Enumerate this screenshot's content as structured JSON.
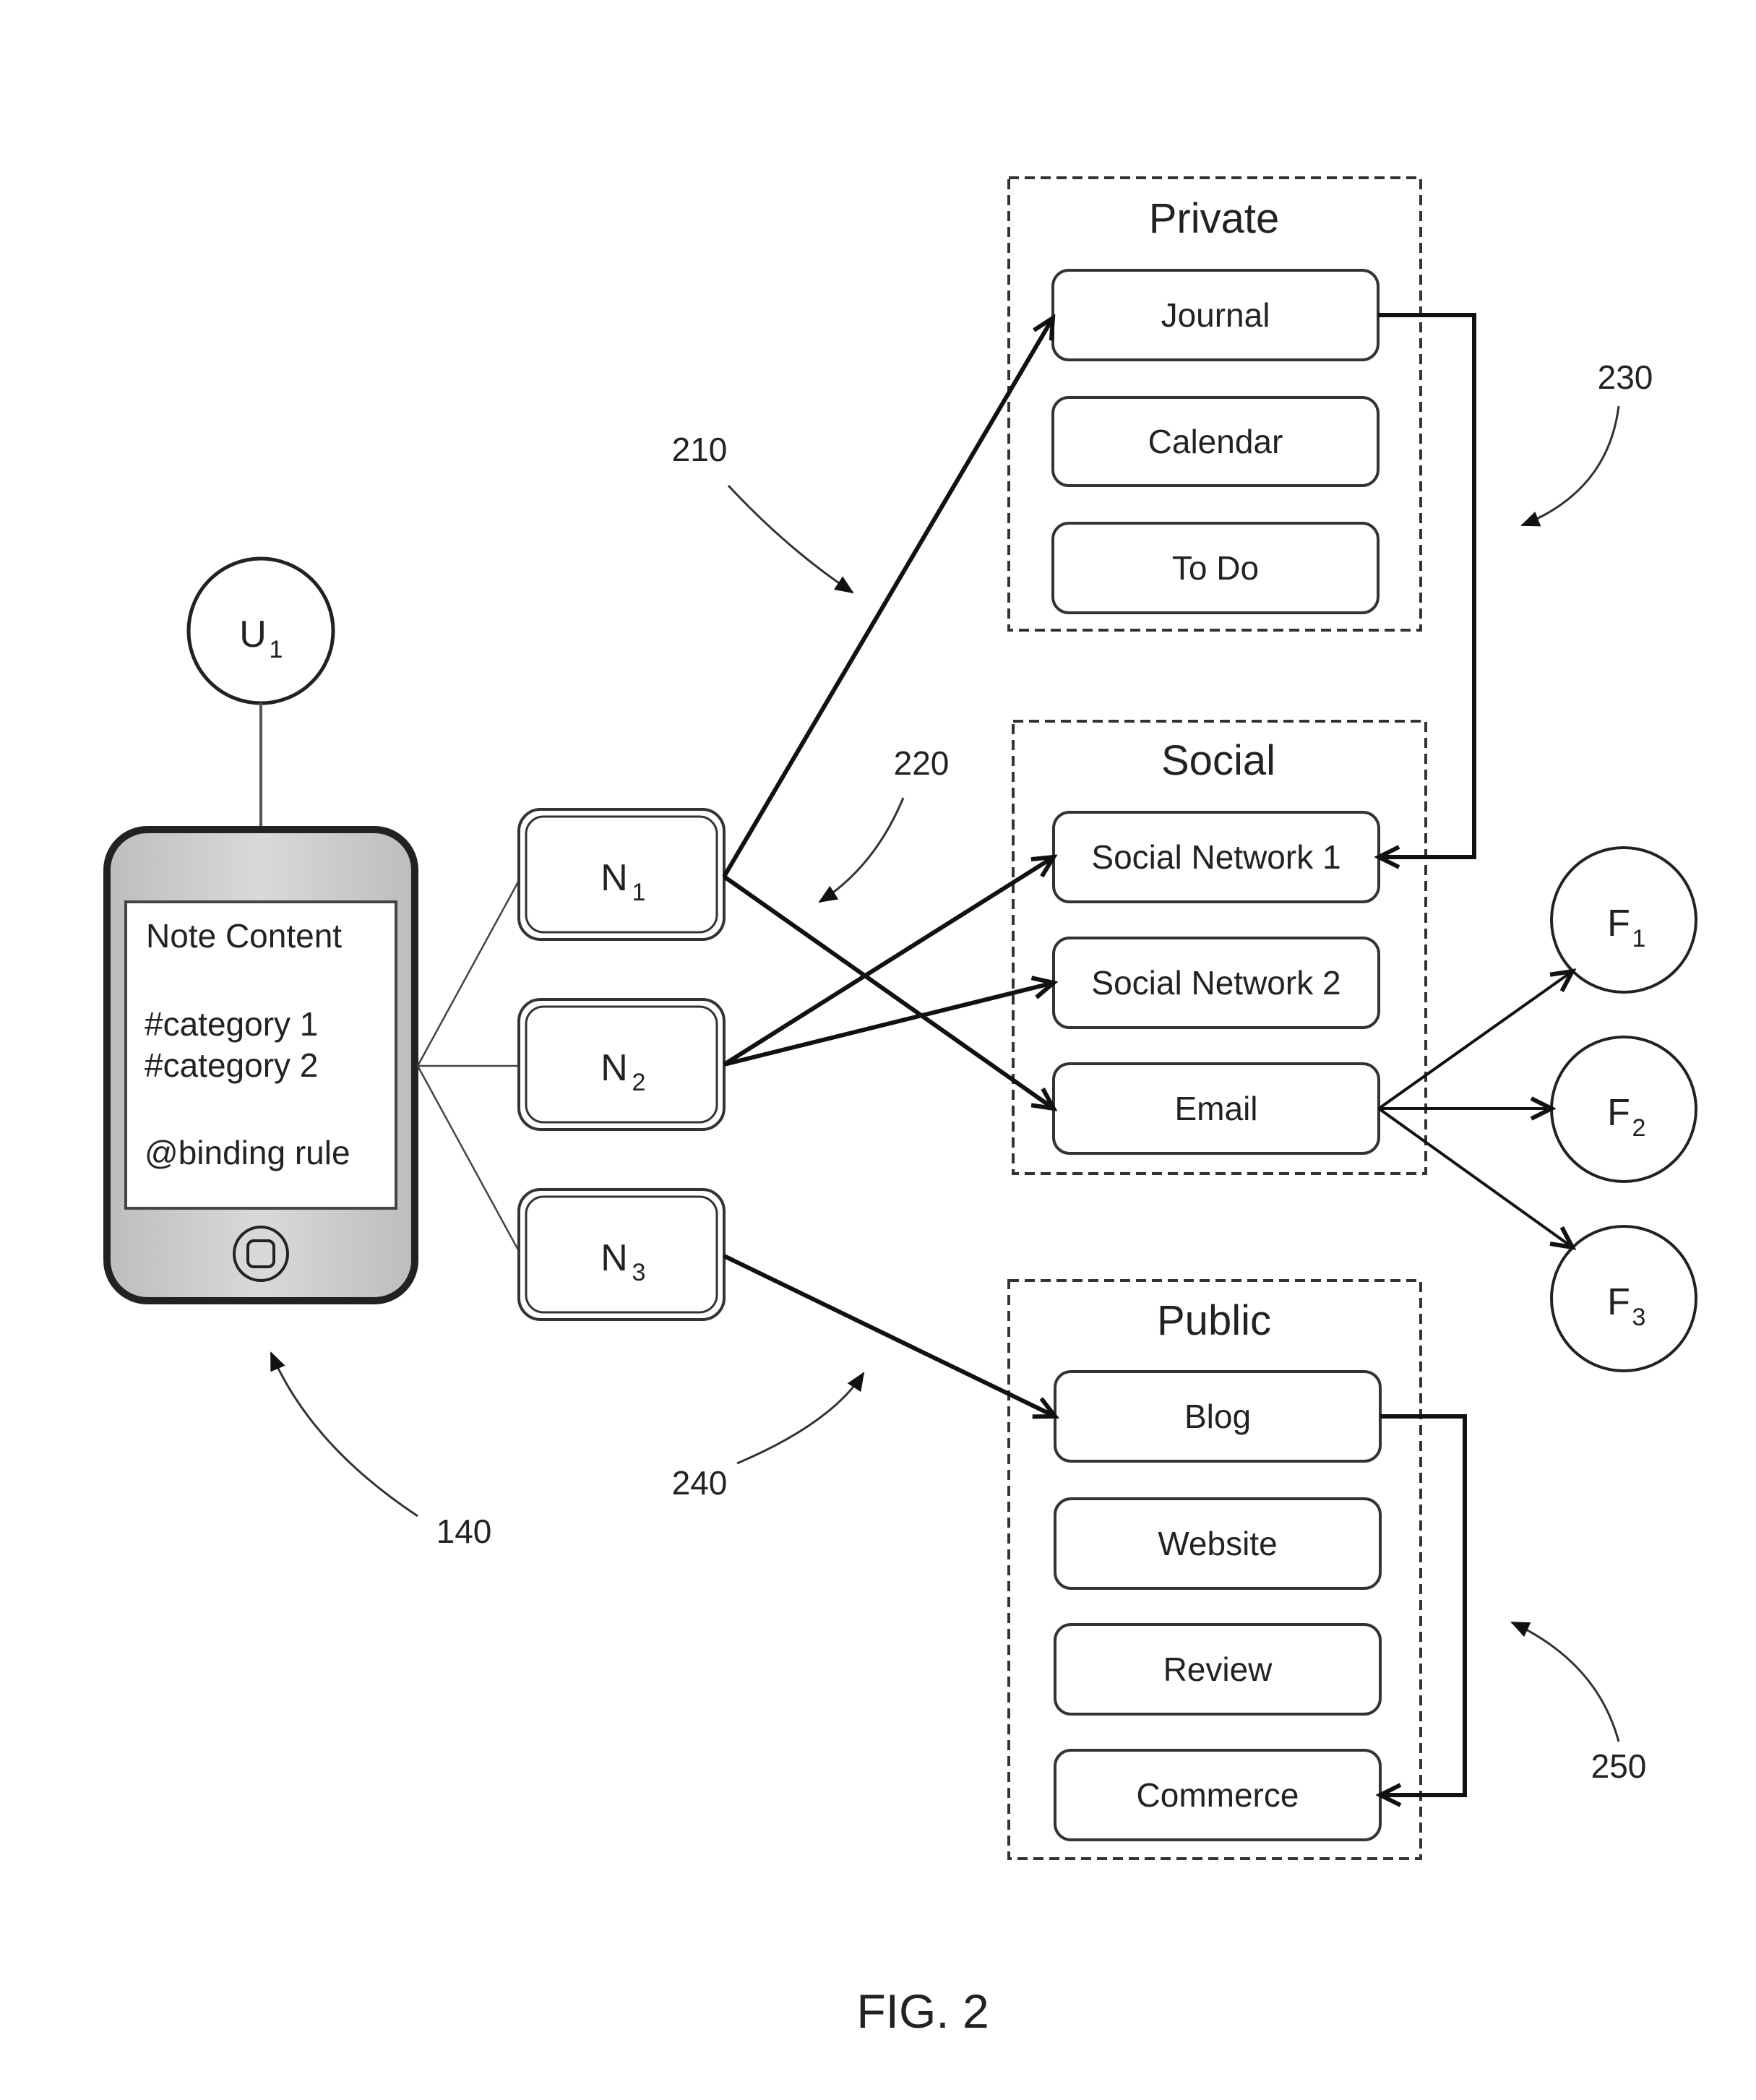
{
  "figure": {
    "caption": "FIG. 2"
  },
  "user": {
    "main": "U",
    "sub": "1"
  },
  "device": {
    "ref": "140",
    "note_lines": [
      "Note Content",
      "#category 1",
      "#category 2",
      "@binding rule"
    ]
  },
  "notes": [
    {
      "main": "N",
      "sub": "1"
    },
    {
      "main": "N",
      "sub": "2"
    },
    {
      "main": "N",
      "sub": "3"
    }
  ],
  "groups": {
    "private": {
      "title": "Private",
      "items": [
        "Journal",
        "Calendar",
        "To Do"
      ]
    },
    "social": {
      "title": "Social",
      "items": [
        "Social Network 1",
        "Social Network 2",
        "Email"
      ]
    },
    "public": {
      "title": "Public",
      "items": [
        "Blog",
        "Website",
        "Review",
        "Commerce"
      ]
    }
  },
  "friends": [
    {
      "main": "F",
      "sub": "1"
    },
    {
      "main": "F",
      "sub": "2"
    },
    {
      "main": "F",
      "sub": "3"
    }
  ],
  "refs": {
    "r210": "210",
    "r220": "220",
    "r230": "230",
    "r240": "240",
    "r250": "250"
  },
  "connections": [
    {
      "from": "N1",
      "to": "Journal"
    },
    {
      "from": "N1",
      "to": "Email"
    },
    {
      "from": "N2",
      "to": "Social Network 1"
    },
    {
      "from": "N2",
      "to": "Social Network 2"
    },
    {
      "from": "N3",
      "to": "Blog"
    },
    {
      "from": "Journal",
      "to": "Social Network 1"
    },
    {
      "from": "Blog",
      "to": "Commerce"
    },
    {
      "from": "Email",
      "to": "F1"
    },
    {
      "from": "Email",
      "to": "F2"
    },
    {
      "from": "Email",
      "to": "F3"
    }
  ]
}
